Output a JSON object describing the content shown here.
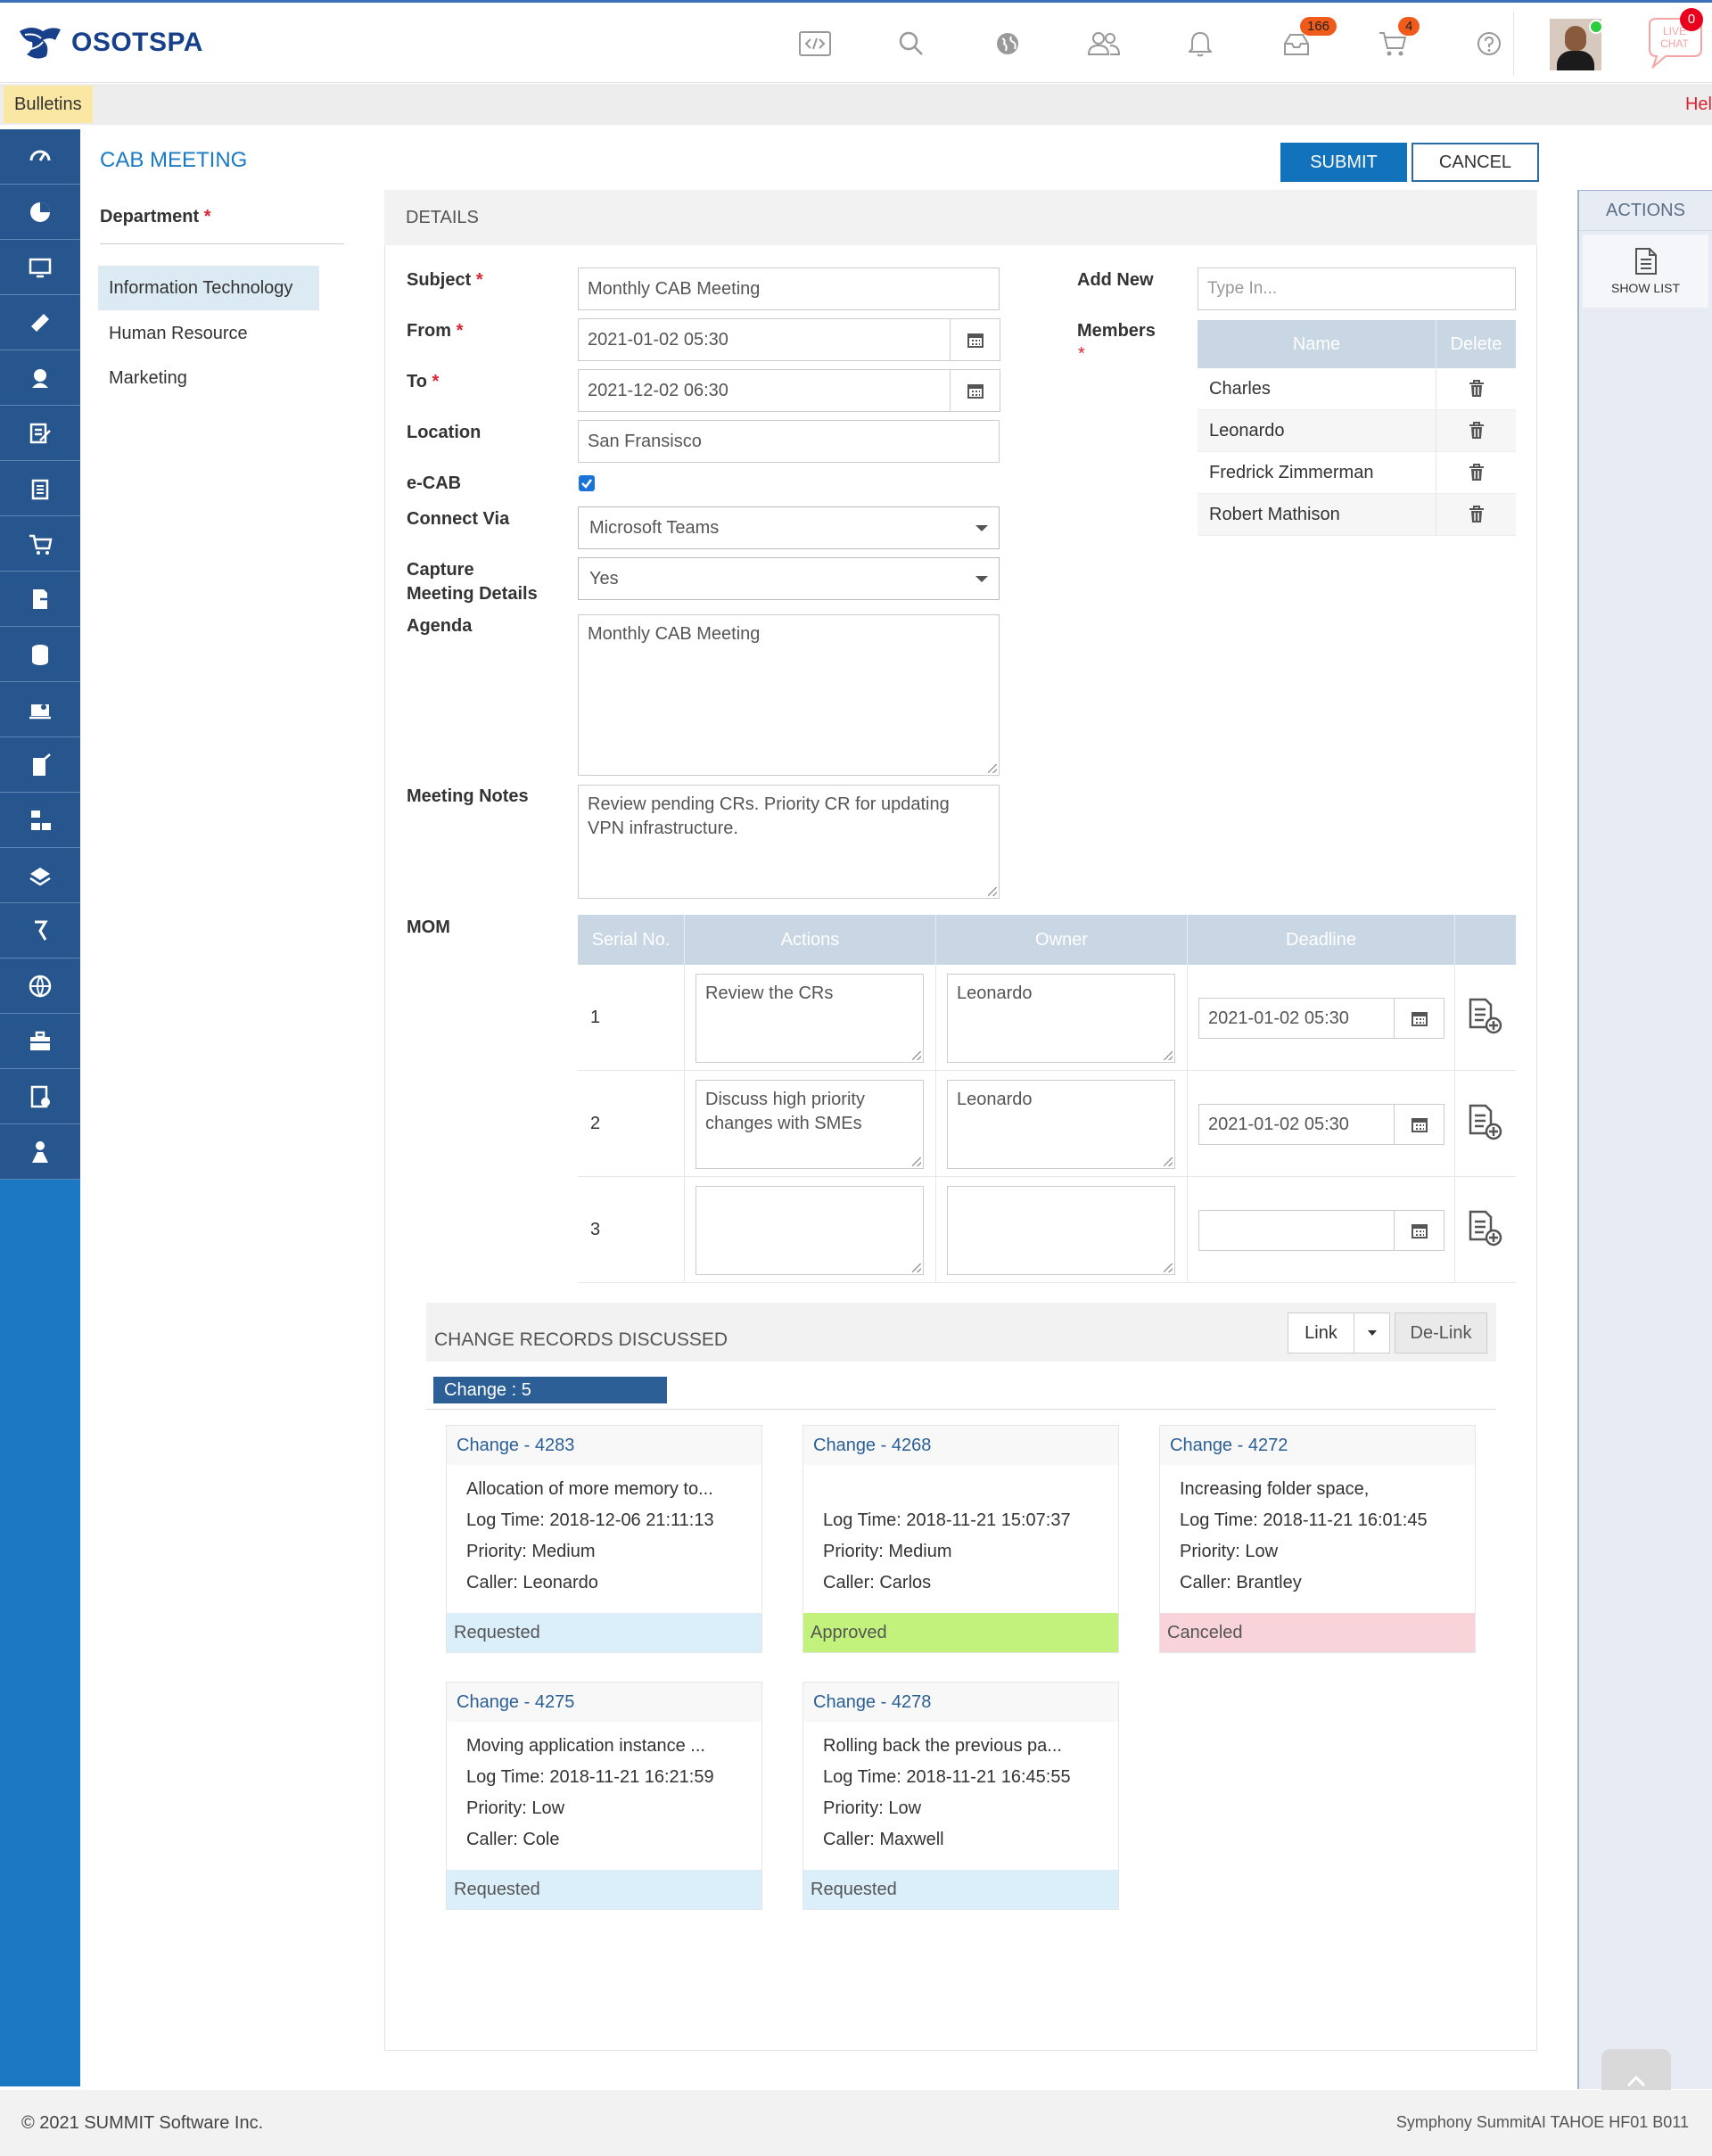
{
  "header": {
    "brand": "OSOTSPA",
    "icons": [
      "code-icon",
      "search-icon",
      "globe-icon",
      "users-icon",
      "bell-icon",
      "inbox-icon",
      "cart-icon",
      "help-icon"
    ],
    "inbox_badge": "166",
    "cart_badge": "4",
    "live_chat_label": "LIVE CHAT",
    "chat_badge": "0"
  },
  "bulletin": {
    "tab_label": "Bulletins",
    "help_text": "Hel"
  },
  "sidebar": {
    "icons": [
      "dashboard-icon",
      "pie-chart-icon",
      "monitor-icon",
      "ticket-icon",
      "user-settings-icon",
      "edit-note-icon",
      "clipboard-icon",
      "cart-icon",
      "document-arrow-icon",
      "database-icon",
      "laptop-user-icon",
      "mobile-edit-icon",
      "org-chart-icon",
      "layers-icon",
      "pin-icon",
      "globe-settings-icon",
      "briefcase-icon",
      "report-icon",
      "person-icon"
    ]
  },
  "page": {
    "title": "CAB MEETING",
    "submit_label": "SUBMIT",
    "cancel_label": "CANCEL"
  },
  "department": {
    "label": "Department",
    "items": [
      "Information Technology",
      "Human Resource",
      "Marketing"
    ]
  },
  "details": {
    "section_title": "DETAILS",
    "subject_label": "Subject",
    "subject_value": "Monthly CAB Meeting",
    "from_label": "From",
    "from_value": "2021-01-02 05:30",
    "to_label": "To",
    "to_value": "2021-12-02 06:30",
    "location_label": "Location",
    "location_value": "San Fransisco",
    "ecab_label": "e-CAB",
    "ecab_checked": true,
    "connect_label": "Connect Via",
    "connect_value": "Microsoft Teams",
    "capture_label_1": "Capture",
    "capture_label_2": "Meeting Details",
    "capture_value": "Yes",
    "agenda_label": "Agenda",
    "agenda_value": "Monthly CAB Meeting",
    "notes_label": "Meeting Notes",
    "notes_value": "Review pending CRs.  Priority CR for updating VPN infrastructure.",
    "mom_label": "MOM"
  },
  "members": {
    "add_label": "Add New",
    "add_placeholder": "Type In...",
    "members_label": "Members",
    "col_name": "Name",
    "col_delete": "Delete",
    "list": [
      "Charles",
      "Leonardo",
      "Fredrick Zimmerman",
      "Robert Mathison"
    ]
  },
  "mom": {
    "cols": [
      "Serial No.",
      "Actions",
      "Owner",
      "Deadline"
    ],
    "rows": [
      {
        "serial": "1",
        "action": "Review the CRs",
        "owner": "Leonardo",
        "deadline": "2021-01-02 05:30"
      },
      {
        "serial": "2",
        "action": "Discuss high priority changes with SMEs",
        "owner": "Leonardo",
        "deadline": "2021-01-02 05:30"
      },
      {
        "serial": "3",
        "action": "",
        "owner": "",
        "deadline": ""
      }
    ]
  },
  "change_records": {
    "title": "CHANGE RECORDS DISCUSSED",
    "link_label": "Link",
    "delink_label": "De-Link",
    "count_label": "Change : 5",
    "cards": [
      {
        "title": "Change - 4283",
        "summary": "Allocation of more memory to...",
        "log_time": "Log Time: 2018-12-06 21:11:13",
        "priority": "Priority: Medium",
        "caller": "Caller: Leonardo",
        "status": "Requested",
        "status_color": "#dbeffa"
      },
      {
        "title": "Change - 4268",
        "summary": "",
        "log_time": "Log Time: 2018-11-21 15:07:37",
        "priority": "Priority: Medium",
        "caller": "Caller: Carlos",
        "status": "Approved",
        "status_color": "#c3f27c"
      },
      {
        "title": "Change - 4272",
        "summary": "Increasing folder space,",
        "log_time": "Log Time: 2018-11-21 16:01:45",
        "priority": "Priority: Low",
        "caller": "Caller: Brantley",
        "status": "Canceled",
        "status_color": "#f8d3da"
      },
      {
        "title": "Change - 4275",
        "summary": "Moving application instance ...",
        "log_time": "Log Time: 2018-11-21 16:21:59",
        "priority": "Priority: Low",
        "caller": "Caller: Cole",
        "status": "Requested",
        "status_color": "#dbeffa"
      },
      {
        "title": "Change - 4278",
        "summary": "Rolling back the previous pa...",
        "log_time": "Log Time: 2018-11-21 16:45:55",
        "priority": "Priority: Low",
        "caller": "Caller: Maxwell",
        "status": "Requested",
        "status_color": "#dbeffa"
      }
    ]
  },
  "actions": {
    "title": "ACTIONS",
    "show_list_label": "SHOW LIST"
  },
  "footer": {
    "copyright": "© 2021 SUMMIT Software Inc.",
    "version": "Symphony SummitAI TAHOE HF01 B011"
  },
  "colors": {
    "accent": "#1272bb",
    "sidebar": "#1b78c2",
    "sidebar_top": "#27568f",
    "table_header": "#c9d6e4"
  }
}
